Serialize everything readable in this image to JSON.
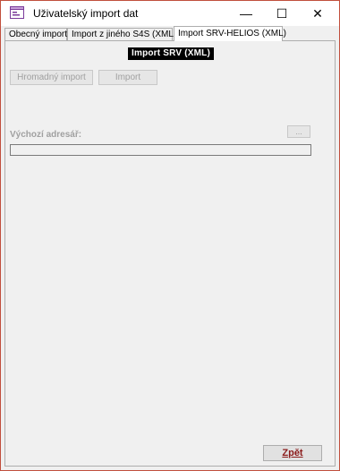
{
  "window": {
    "title": "Uživatelský import dat",
    "minimize_glyph": "—",
    "maximize_glyph": "☐",
    "close_glyph": "✕"
  },
  "tabs": [
    {
      "label": "Obecný import",
      "active": false
    },
    {
      "label": "Import z jiného S4S (XML)",
      "active": false
    },
    {
      "label": "Import SRV-HELIOS (XML)",
      "active": true
    }
  ],
  "panel": {
    "heading": "Import SRV (XML)",
    "mass_import_label": "Hromadný import",
    "import_label": "Import",
    "dir_label": "Výchozí adresář:",
    "dir_value": "",
    "browse_label": "...",
    "back_label": "Zpět"
  },
  "colors": {
    "window_border": "#c14f3d",
    "back_text": "#8b1a1a",
    "disabled_text": "#a0a0a0"
  }
}
